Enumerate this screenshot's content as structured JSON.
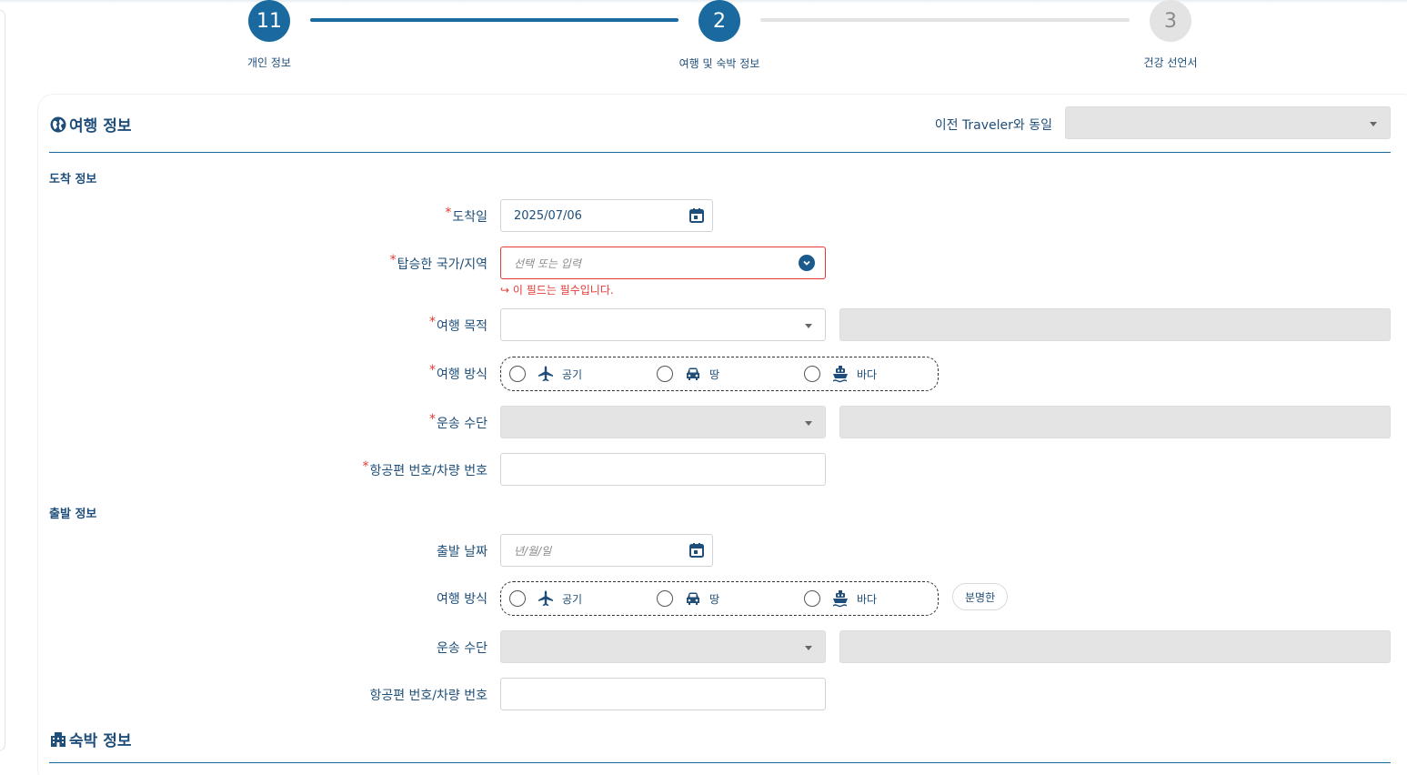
{
  "stepper": {
    "steps": [
      {
        "number": "11",
        "label": "개인 정보"
      },
      {
        "number": "2",
        "label": "여행 및 숙박 정보"
      },
      {
        "number": "3",
        "label": "건강 선언서"
      }
    ]
  },
  "travel_section": {
    "title": "여행 정보",
    "same_as_label": "이전 Traveler와 동일",
    "same_as_value": ""
  },
  "arrival": {
    "subtitle": "도착 정보",
    "date_label": "도착일",
    "date_value": "2025/07/06",
    "country_label": "탑승한 국가/지역",
    "country_placeholder": "선택 또는 입력",
    "country_error": "↪ 이 필드는 필수입니다.",
    "purpose_label": "여행 목적",
    "mode_label": "여행 방식",
    "transport_label": "운송 수단",
    "flight_label": "항공편 번호/차량 번호"
  },
  "departure": {
    "subtitle": "출발 정보",
    "date_label": "출발 날짜",
    "date_placeholder": "년/월/일",
    "mode_label": "여행 방식",
    "clear_label": "분명한",
    "transport_label": "운송 수단",
    "flight_label": "항공편 번호/차량 번호"
  },
  "travel_modes": {
    "air": "공기",
    "land": "땅",
    "sea": "바다"
  },
  "lodging_section": {
    "title": "숙박 정보"
  },
  "required_mark": "*",
  "colors": {
    "primary": "#1a6aa0",
    "heading": "#1e4e79",
    "error": "#e53935",
    "disabled": "#e4e4e4"
  }
}
